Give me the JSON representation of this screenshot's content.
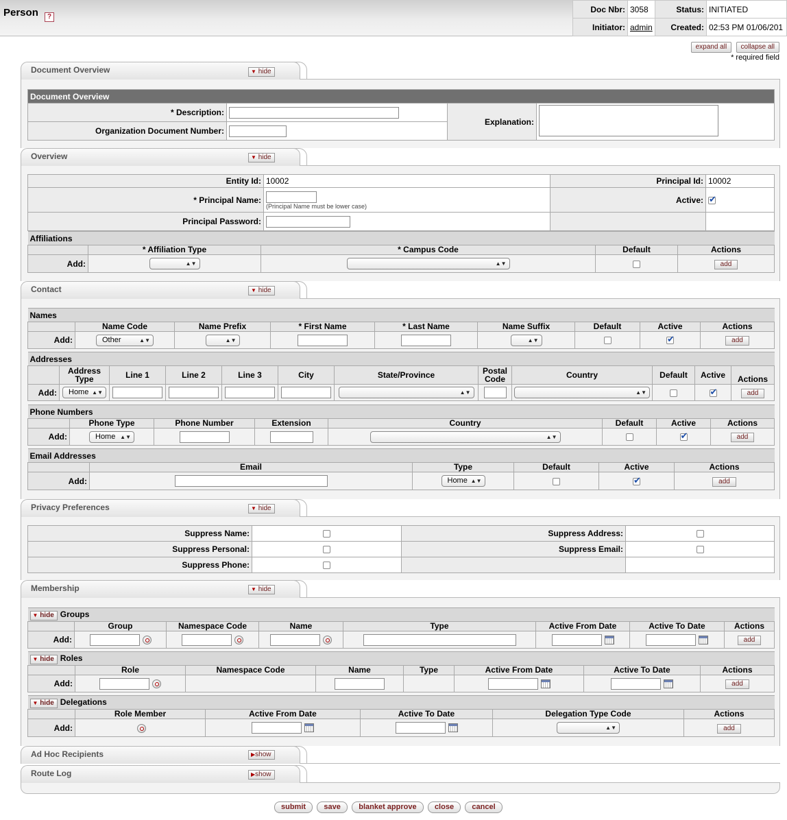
{
  "header": {
    "title": "Person",
    "help_icon": "?",
    "doc_nbr_label": "Doc Nbr:",
    "doc_nbr": "3058",
    "status_label": "Status:",
    "status": "INITIATED",
    "initiator_label": "Initiator:",
    "initiator": "admin",
    "created_label": "Created:",
    "created": "02:53 PM 01/06/201"
  },
  "top_buttons": {
    "expand_all": "expand all",
    "collapse_all": "collapse all",
    "required_note": "* required field"
  },
  "tabs": {
    "document_overview": {
      "title": "Document Overview",
      "toggle": "hide"
    },
    "overview": {
      "title": "Overview",
      "toggle": "hide"
    },
    "contact": {
      "title": "Contact",
      "toggle": "hide"
    },
    "privacy": {
      "title": "Privacy Preferences",
      "toggle": "hide"
    },
    "membership": {
      "title": "Membership",
      "toggle": "hide"
    },
    "adhoc": {
      "title": "Ad Hoc Recipients",
      "toggle": "show"
    },
    "routelog": {
      "title": "Route Log",
      "toggle": "show"
    }
  },
  "document_overview": {
    "header": "Document Overview",
    "description_label": "* Description:",
    "org_doc_number_label": "Organization Document Number:",
    "explanation_label": "Explanation:"
  },
  "overview": {
    "entity_id_label": "Entity Id:",
    "entity_id": "10002",
    "principal_id_label": "Principal Id:",
    "principal_id": "10002",
    "principal_name_label": "* Principal Name:",
    "principal_name_hint": "(Principal Name must be lower case)",
    "active_label": "Active:",
    "principal_password_label": "Principal Password:",
    "affiliations": {
      "title": "Affiliations",
      "columns": [
        "* Affiliation Type",
        "* Campus Code",
        "Default",
        "Actions"
      ],
      "add_label": "Add:",
      "add_button": "add"
    }
  },
  "contact": {
    "names": {
      "title": "Names",
      "columns": [
        "Name Code",
        "Name Prefix",
        "* First Name",
        "* Last Name",
        "Name Suffix",
        "Default",
        "Active",
        "Actions"
      ],
      "name_code_value": "Other",
      "add_label": "Add:",
      "add_button": "add"
    },
    "addresses": {
      "title": "Addresses",
      "columns": [
        "Address Type",
        "Line 1",
        "Line 2",
        "Line 3",
        "City",
        "State/Province",
        "Postal Code",
        "Country",
        "Default",
        "Active",
        "Actions"
      ],
      "address_type_value": "Home",
      "add_label": "Add:",
      "add_button": "add"
    },
    "phones": {
      "title": "Phone Numbers",
      "columns": [
        "Phone Type",
        "Phone Number",
        "Extension",
        "Country",
        "Default",
        "Active",
        "Actions"
      ],
      "phone_type_value": "Home",
      "add_label": "Add:",
      "add_button": "add"
    },
    "emails": {
      "title": "Email Addresses",
      "columns": [
        "Email",
        "Type",
        "Default",
        "Active",
        "Actions"
      ],
      "type_value": "Home",
      "add_label": "Add:",
      "add_button": "add"
    }
  },
  "privacy": {
    "suppress_name": "Suppress Name:",
    "suppress_address": "Suppress Address:",
    "suppress_personal": "Suppress Personal:",
    "suppress_email": "Suppress Email:",
    "suppress_phone": "Suppress Phone:"
  },
  "membership": {
    "groups": {
      "toggle": "hide",
      "title": "Groups",
      "columns": [
        "Group",
        "Namespace Code",
        "Name",
        "Type",
        "Active From Date",
        "Active To Date",
        "Actions"
      ],
      "add_label": "Add:",
      "add_button": "add"
    },
    "roles": {
      "toggle": "hide",
      "title": "Roles",
      "columns": [
        "Role",
        "Namespace Code",
        "Name",
        "Type",
        "Active From Date",
        "Active To Date",
        "Actions"
      ],
      "add_label": "Add:",
      "add_button": "add"
    },
    "delegations": {
      "toggle": "hide",
      "title": "Delegations",
      "columns": [
        "Role Member",
        "Active From Date",
        "Active To Date",
        "Delegation Type Code",
        "Actions"
      ],
      "add_label": "Add:",
      "add_button": "add"
    }
  },
  "bottom_buttons": [
    "submit",
    "save",
    "blanket approve",
    "close",
    "cancel"
  ]
}
